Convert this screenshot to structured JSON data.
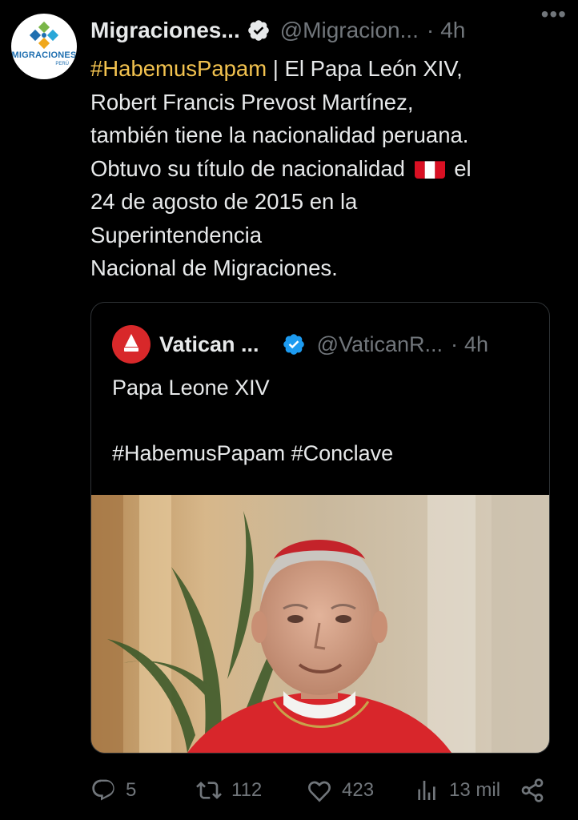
{
  "author": {
    "avatar_logo_text": "MIGRACIONES",
    "avatar_logo_sub": "PERÚ",
    "name": "Migraciones...",
    "handle": "@Migracion...",
    "separator": "·",
    "time": "4h",
    "more_label": "•••"
  },
  "body": {
    "hashtag": "#HabemusPapam",
    "line1_rest": " | El Papa León XIV,",
    "line2": "Robert Francis Prevost Martínez,",
    "line3": "también tiene la nacionalidad peruana.",
    "line4_before_flag": "Obtuvo su título de nacionalidad",
    "line4_after_flag": "el",
    "line5": "24 de agosto de 2015 en la",
    "line6": "Superintendencia",
    "line7": "Nacional de Migraciones."
  },
  "quote": {
    "name": "Vatican ...",
    "handle": "@VaticanR...",
    "separator": "·",
    "time": "4h",
    "text_line1": "Papa Leone XIV",
    "text_line2": "#HabemusPapam #Conclave"
  },
  "actions": {
    "replies": "5",
    "reposts": "112",
    "likes": "423",
    "views": "13 mil"
  },
  "colors": {
    "background": "#000000",
    "text": "#e7e9ea",
    "muted": "#71767b",
    "hashtag": "#f2c24f",
    "verified": "#1d9bf0",
    "border": "#2f3336"
  }
}
